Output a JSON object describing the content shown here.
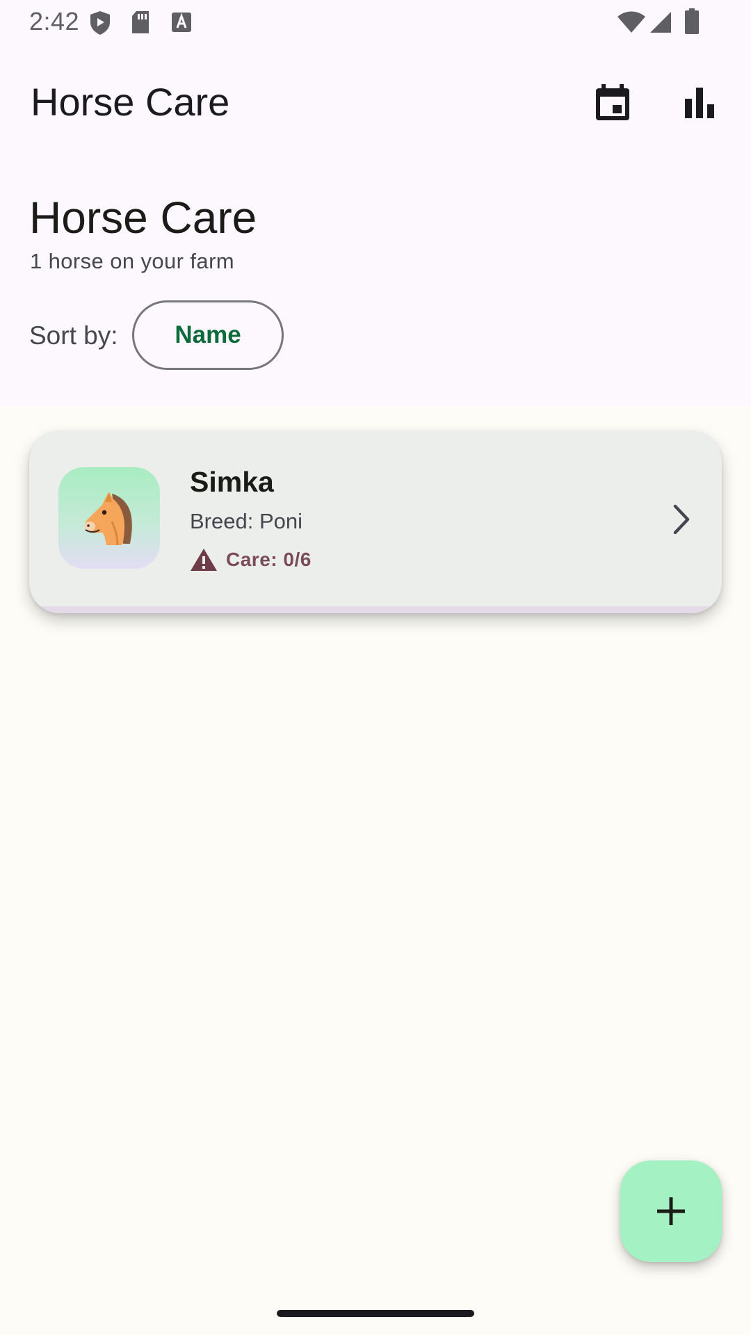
{
  "status_bar": {
    "time": "2:42",
    "icons": [
      "shield-icon",
      "sd-card-icon",
      "font-a-icon",
      "wifi-icon",
      "cell-signal-icon",
      "battery-icon"
    ]
  },
  "app_bar": {
    "title": "Horse Care",
    "actions": [
      {
        "icon": "calendar-icon"
      },
      {
        "icon": "bar-chart-icon"
      }
    ]
  },
  "header": {
    "heading": "Horse Care",
    "subtitle": "1 horse on your farm",
    "sort_label": "Sort by:",
    "sort_value": "Name"
  },
  "horses": [
    {
      "name": "Simka",
      "breed": "Breed: Poni",
      "care": "Care: 0/6",
      "avatar_icon": "horse-face-icon",
      "status_icon": "warning-icon"
    }
  ],
  "fab": {
    "icon": "plus-icon"
  },
  "colors": {
    "accent": "#0d6a3a",
    "fab": "#a4f2c3",
    "card": "#eceeec",
    "care_warning": "#7a4b59",
    "header_bg": "#fdf8fe",
    "content_bg": "#fdfcf6"
  }
}
